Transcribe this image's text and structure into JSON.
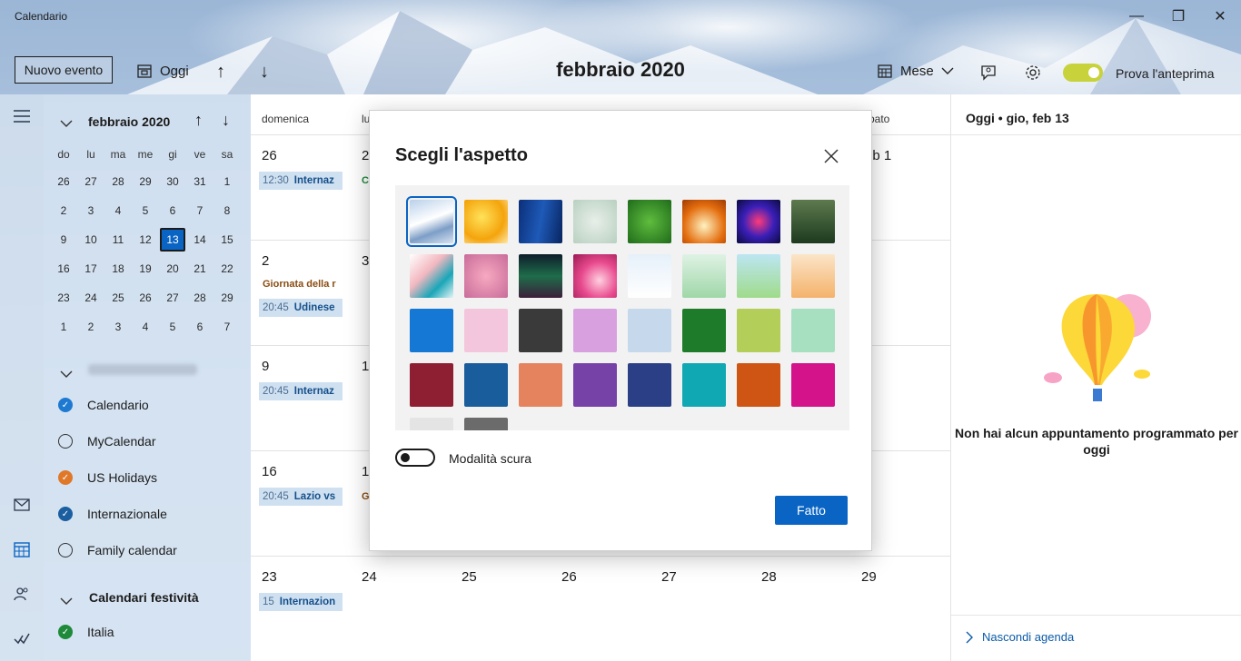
{
  "window": {
    "title": "Calendario",
    "minimize": "—",
    "maximize": "❐",
    "close": "✕"
  },
  "toolbar": {
    "new_event": "Nuovo evento",
    "today": "Oggi",
    "up_arrow": "↑",
    "down_arrow": "↓",
    "month_title": "febbraio 2020",
    "view": "Mese",
    "preview": "Prova l'anteprima"
  },
  "mini_calendar": {
    "title": "febbraio 2020",
    "dow": [
      "do",
      "lu",
      "ma",
      "me",
      "gi",
      "ve",
      "sa"
    ],
    "weeks": [
      [
        "26",
        "27",
        "28",
        "29",
        "30",
        "31",
        "1"
      ],
      [
        "2",
        "3",
        "4",
        "5",
        "6",
        "7",
        "8"
      ],
      [
        "9",
        "10",
        "11",
        "12",
        "13",
        "14",
        "15"
      ],
      [
        "16",
        "17",
        "18",
        "19",
        "20",
        "21",
        "22"
      ],
      [
        "23",
        "24",
        "25",
        "26",
        "27",
        "28",
        "29"
      ],
      [
        "1",
        "2",
        "3",
        "4",
        "5",
        "6",
        "7"
      ]
    ],
    "today": "13"
  },
  "calendars": {
    "account": "",
    "items": [
      {
        "label": "Calendario",
        "color": "#1e7ad1",
        "checked": true
      },
      {
        "label": "MyCalendar",
        "color": "#ffffff",
        "checked": false
      },
      {
        "label": "US Holidays",
        "color": "#e0782a",
        "checked": true
      },
      {
        "label": "Internazionale",
        "color": "#1b5fa0",
        "checked": true
      },
      {
        "label": "Family calendar",
        "color": "#ffffff",
        "checked": false
      }
    ],
    "holidays_group": "Calendari festività",
    "holiday_items": [
      {
        "label": "Italia",
        "color": "#1e8a3a",
        "checked": true
      }
    ]
  },
  "month_grid": {
    "day_header_first": "domenica",
    "day_header_partial_lu": "lu",
    "day_header_partial_sa": "bato",
    "rows": [
      {
        "sun": "26",
        "mon_partial": "2",
        "sat_partial": "eb 1",
        "events": [
          {
            "time": "12:30",
            "title": "Internaz"
          }
        ],
        "mon_event_partial": "C"
      },
      {
        "sun": "2",
        "mon_partial": "3",
        "plain_event": "Giornata della r",
        "events": [
          {
            "time": "20:45",
            "title": "Udinese"
          }
        ]
      },
      {
        "sun": "9",
        "mon_partial": "1",
        "sat_partial": "5",
        "events": [
          {
            "time": "20:45",
            "title": "Internaz"
          }
        ]
      },
      {
        "sun": "16",
        "mon_partial": "1",
        "sat_partial": "2",
        "events": [
          {
            "time": "20:45",
            "title": "Lazio vs"
          }
        ],
        "mon_event_partial": "G"
      },
      {
        "sun": "23",
        "others": [
          "24",
          "25",
          "26",
          "27",
          "28",
          "29"
        ],
        "events": [
          {
            "time": "15",
            "title": "Internazion"
          }
        ]
      }
    ]
  },
  "agenda": {
    "header": "Oggi • gio, feb 13",
    "empty": "Non hai alcun appuntamento programmato per oggi",
    "hide": "Nascondi agenda"
  },
  "dialog": {
    "title": "Scegli l'aspetto",
    "dark_mode": "Modalità scura",
    "done": "Fatto",
    "swatch_colors_row3": [
      "#1478d4",
      "#f4c6dd",
      "#3a3a3a",
      "#d9a0df",
      "#c6d9ec",
      "#1e7b2a",
      "#b3cf5a",
      "#a6e0c0"
    ],
    "swatch_colors_row4": [
      "#8e1f33",
      "#1a5d9c",
      "#e5835f",
      "#7642a8",
      "#2b3f86",
      "#10a8b2",
      "#cf5514",
      "#d41289"
    ]
  }
}
